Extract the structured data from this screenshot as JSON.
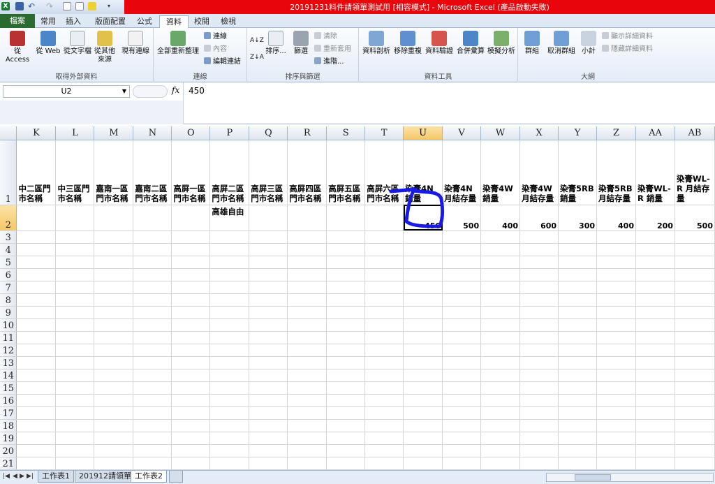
{
  "window": {
    "title": "20191231料件請領單測試用 [相容模式] - Microsoft Excel (產品啟動失敗)",
    "accent_color": "#e8050c"
  },
  "quick_access": [
    "excel-logo-icon",
    "save-icon",
    "undo-icon",
    "redo-icon",
    "new-icon",
    "print-preview-icon",
    "highlight-icon",
    "customize-icon"
  ],
  "ribbon_tabs": [
    "檔案",
    "常用",
    "插入",
    "版面配置",
    "公式",
    "資料",
    "校閱",
    "檢視"
  ],
  "active_tab": "資料",
  "ribbon": {
    "external": {
      "label": "取得外部資料",
      "buttons": [
        "從 Access",
        "從 Web",
        "從文字檔",
        "從其他\n來源",
        "現有連線"
      ]
    },
    "connections": {
      "label": "連線",
      "refresh": "全部重新整理",
      "items": [
        "連線",
        "內容",
        "編輯連結"
      ]
    },
    "sort": {
      "label": "排序與篩選",
      "sort": "排序...",
      "filter": "篩選",
      "items": [
        "清除",
        "重新套用",
        "進階..."
      ]
    },
    "tools": {
      "label": "資料工具",
      "buttons": [
        "資料剖析",
        "移除重複",
        "資料驗證",
        "合併彙算",
        "模擬分析"
      ]
    },
    "outline": {
      "label": "大綱",
      "buttons": [
        "群組",
        "取消群組",
        "小計"
      ],
      "items": [
        "顯示詳細資料",
        "隱藏詳細資料"
      ]
    }
  },
  "formula_bar": {
    "name_box": "U2",
    "fx": "fx",
    "value": "450"
  },
  "columns": [
    "K",
    "L",
    "M",
    "N",
    "O",
    "P",
    "Q",
    "R",
    "S",
    "T",
    "U",
    "V",
    "W",
    "X",
    "Y",
    "Z",
    "AA",
    "AB"
  ],
  "selected_column": "U",
  "header_row": [
    "中二區門市名稱",
    "中三區門市名稱",
    "嘉南一區門市名稱",
    "嘉南二區門市名稱",
    "高屏一區門市名稱",
    "高屏二區門市名稱",
    "高屏三區門市名稱",
    "高屏四區門市名稱",
    "高屏五區門市名稱",
    "高屏六區門市名稱",
    "染膏4N 銷量",
    "染膏4N 月結存量",
    "染膏4W 銷量",
    "染膏4W 月結存量",
    "染膏5RB 銷量",
    "染膏5RB 月結存量",
    "染膏WL-R 銷量",
    "染膏WL-R 月結存量"
  ],
  "row2": [
    "",
    "",
    "",
    "",
    "",
    "高雄自由",
    "",
    "",
    "",
    "",
    "450",
    "500",
    "400",
    "600",
    "300",
    "400",
    "200",
    "500"
  ],
  "row_numbers": [
    "1",
    "2",
    "3",
    "4",
    "5",
    "6",
    "7",
    "8",
    "9",
    "10",
    "11",
    "12",
    "13",
    "14",
    "15",
    "16",
    "17",
    "18",
    "19",
    "20",
    "21"
  ],
  "selected_row": "2",
  "sheet_tabs": [
    "工作表1",
    "201912請領單",
    "工作表2"
  ],
  "active_sheet": "工作表2",
  "annotation_color": "#1a1ae6"
}
